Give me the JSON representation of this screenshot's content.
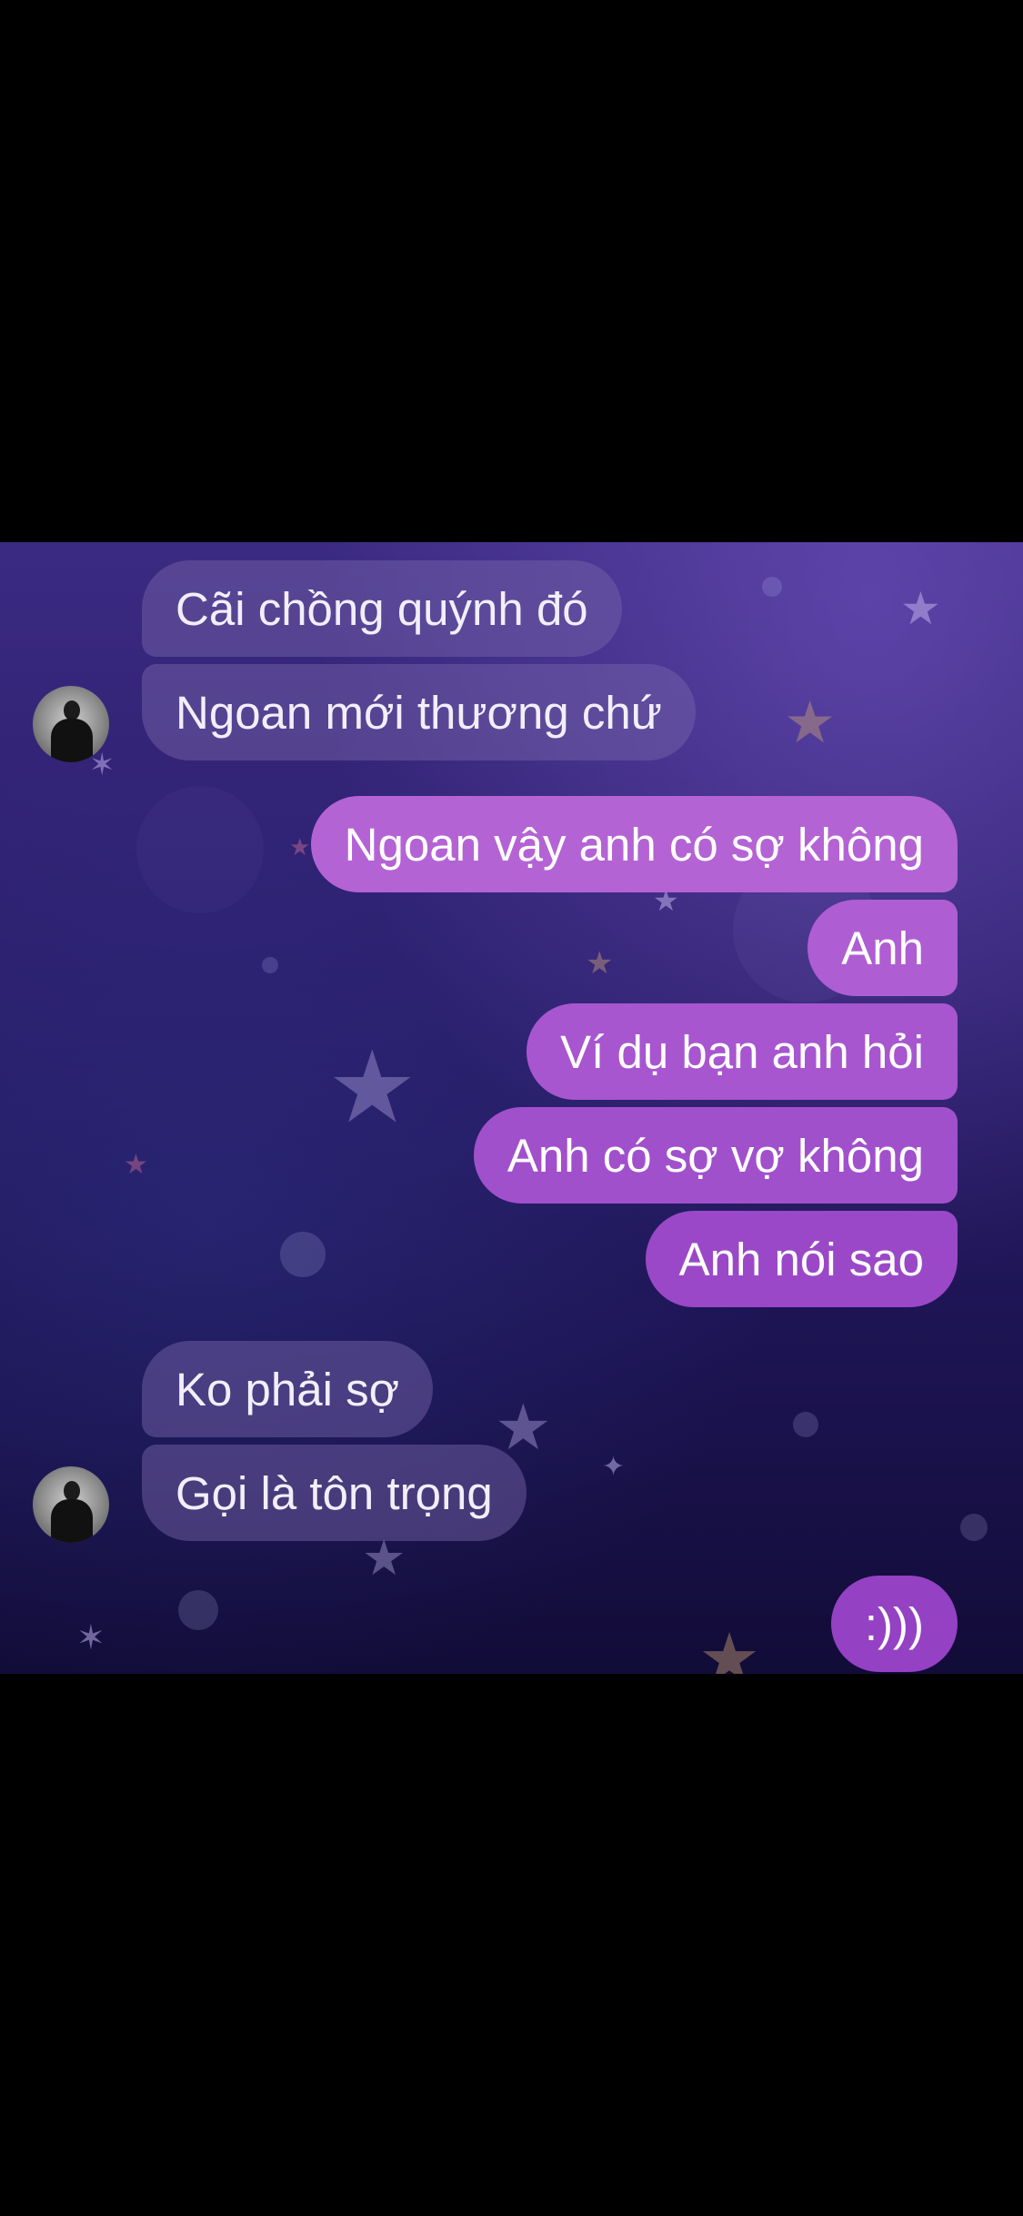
{
  "contact": {
    "avatar_icon": "profile-photo-avatar"
  },
  "theme": {
    "incoming_bubble": "#6a5a9c",
    "outgoing_bubble_top": "#b668d6",
    "outgoing_bubble_bottom": "#9a45c8"
  },
  "messages": [
    {
      "dir": "in",
      "text": "Cãi chồng quýnh đó"
    },
    {
      "dir": "in",
      "text": "Ngoan mới thương chứ"
    },
    {
      "dir": "out",
      "text": "Ngoan vậy anh có sợ không"
    },
    {
      "dir": "out",
      "text": "Anh"
    },
    {
      "dir": "out",
      "text": "Ví dụ bạn anh hỏi"
    },
    {
      "dir": "out",
      "text": "Anh có sợ vợ không"
    },
    {
      "dir": "out",
      "text": "Anh nói sao"
    },
    {
      "dir": "in",
      "text": "Ko phải sợ"
    },
    {
      "dir": "in",
      "text": "Gọi là tôn trọng"
    },
    {
      "dir": "out",
      "text": ":)))"
    }
  ]
}
